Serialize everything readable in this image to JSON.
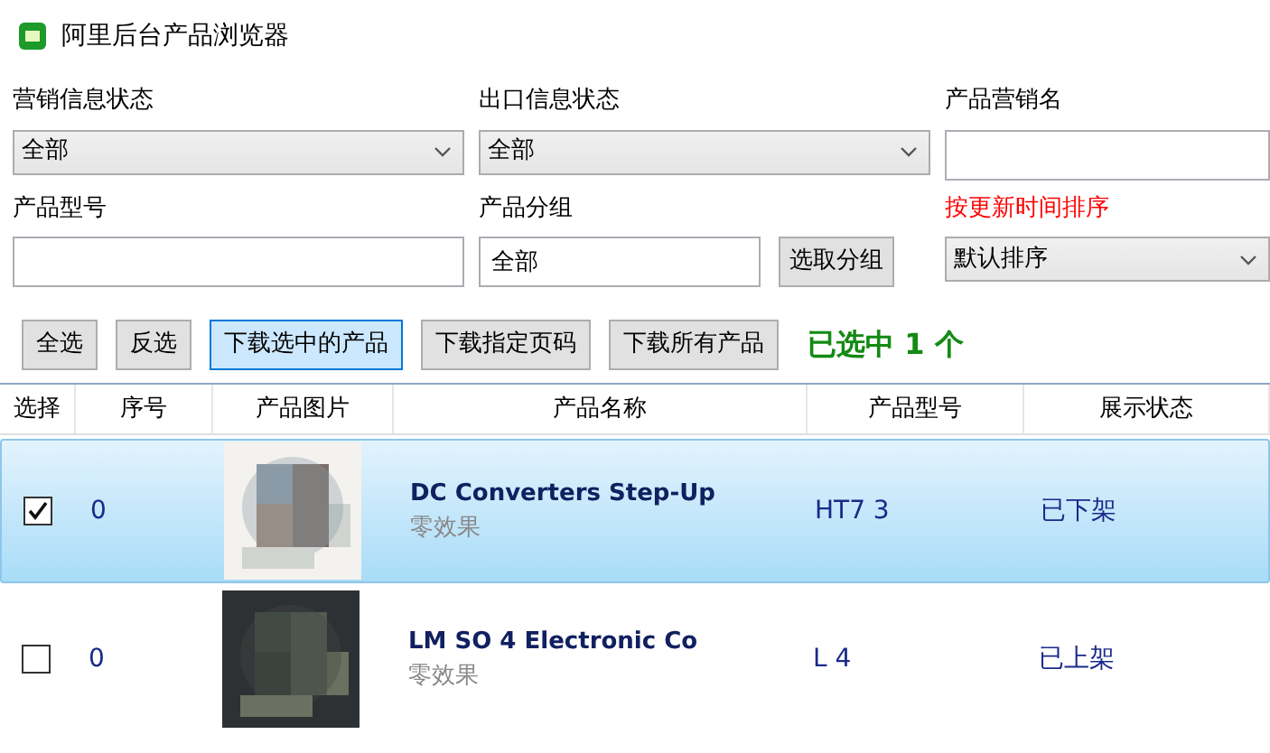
{
  "window": {
    "title": "阿里后台产品浏览器"
  },
  "filters": [
    {
      "kind": "select",
      "label": "营销信息状态",
      "value": "全部",
      "warning": false
    },
    {
      "kind": "select",
      "label": "出口信息状态",
      "value": "全部",
      "warning": false
    },
    {
      "kind": "input",
      "label": "产品营销名",
      "warning": false
    },
    {
      "kind": "input",
      "label": "产品型号",
      "warning": false
    },
    {
      "kind": "group",
      "label": "产品分组",
      "value": "全部",
      "button": "选取分组",
      "warning": false
    },
    {
      "kind": "select",
      "label": "按更新时间排序",
      "value": "默认排序",
      "warning": true
    }
  ],
  "actions": [
    {
      "label": "全选",
      "selected": false
    },
    {
      "label": "反选",
      "selected": false
    },
    {
      "label": "下载选中的产品",
      "selected": true
    },
    {
      "label": "下载指定页码",
      "selected": false
    },
    {
      "label": "下载所有产品",
      "selected": false
    }
  ],
  "selection_count": "已选中 1 个",
  "table": {
    "columns": [
      "选择",
      "序号",
      "产品图片",
      "产品名称",
      "产品型号",
      "展示状态"
    ],
    "rows": [
      {
        "checked": true,
        "selected": true,
        "index": "0",
        "name": "DC Converters Step-Up",
        "subtitle": "零效果",
        "model": "HT7 3",
        "status": "已下架"
      },
      {
        "checked": false,
        "selected": false,
        "index": "0",
        "name": "LM SO 4 Electronic Co",
        "subtitle": "零效果",
        "model": "L 4",
        "status": "已上架"
      }
    ]
  }
}
